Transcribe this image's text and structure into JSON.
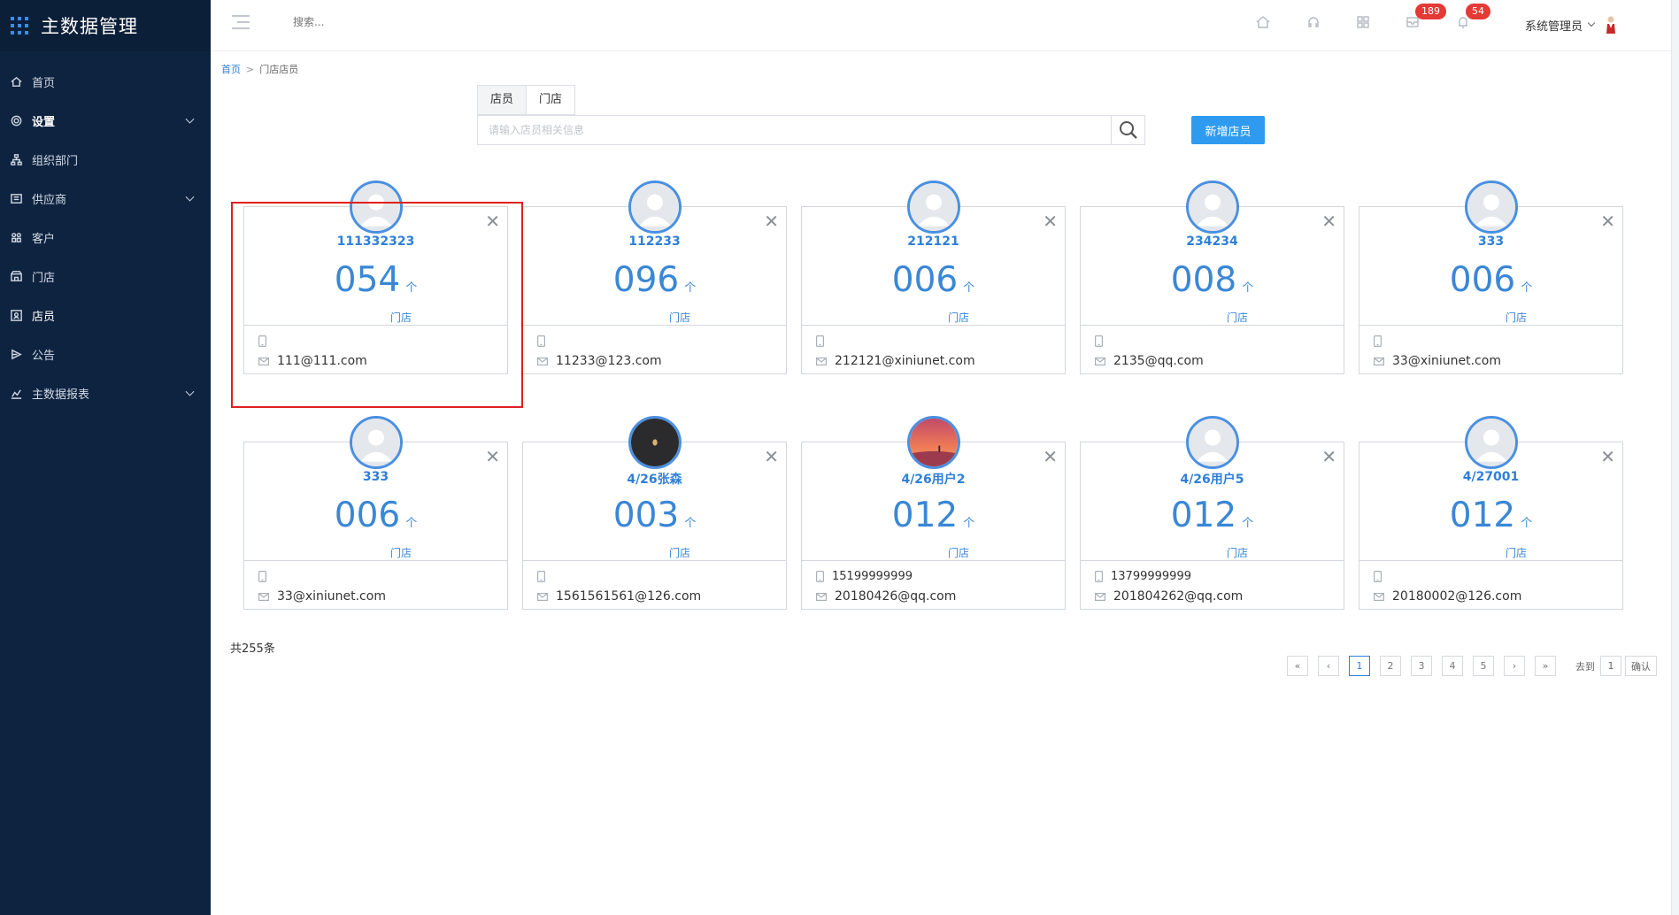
{
  "app": {
    "title": "主数据管理"
  },
  "sidebar": {
    "items": [
      {
        "label": "首页",
        "icon": "home-icon",
        "expandable": false
      },
      {
        "label": "设置",
        "icon": "gear-icon",
        "expandable": true
      },
      {
        "label": "组织部门",
        "icon": "org-chart-icon",
        "expandable": false
      },
      {
        "label": "供应商",
        "icon": "supplier-icon",
        "expandable": true
      },
      {
        "label": "客户",
        "icon": "customer-icon",
        "expandable": false
      },
      {
        "label": "门店",
        "icon": "store-icon",
        "expandable": false
      },
      {
        "label": "店员",
        "icon": "clerk-icon",
        "expandable": false,
        "active": true
      },
      {
        "label": "公告",
        "icon": "announcement-icon",
        "expandable": false
      },
      {
        "label": "主数据报表",
        "icon": "chart-icon",
        "expandable": true
      }
    ]
  },
  "topbar": {
    "search_placeholder": "搜索...",
    "messages_badge": "189",
    "notifications_badge": "54",
    "user_name": "系统管理员"
  },
  "breadcrumb": {
    "home": "首页",
    "separator": ">",
    "current": "门店店员"
  },
  "tabs": [
    {
      "label": "店员",
      "active": true
    },
    {
      "label": "门店",
      "active": false
    }
  ],
  "search": {
    "placeholder": "请输入店员相关信息",
    "value": ""
  },
  "add_button": "新增店员",
  "cards": [
    {
      "name": "111332323",
      "count": "054",
      "unit": "个",
      "link": "门店",
      "phone": "",
      "email": "111@111.com",
      "avatar": "default"
    },
    {
      "name": "112233",
      "count": "096",
      "unit": "个",
      "link": "门店",
      "phone": "",
      "email": "11233@123.com",
      "avatar": "default"
    },
    {
      "name": "212121",
      "count": "006",
      "unit": "个",
      "link": "门店",
      "phone": "",
      "email": "212121@xiniunet.com",
      "avatar": "default"
    },
    {
      "name": "234234",
      "count": "008",
      "unit": "个",
      "link": "门店",
      "phone": "",
      "email": "2135@qq.com",
      "avatar": "default"
    },
    {
      "name": "333",
      "count": "006",
      "unit": "个",
      "link": "门店",
      "phone": "",
      "email": "33@xiniunet.com",
      "avatar": "default"
    },
    {
      "name": "333",
      "count": "006",
      "unit": "个",
      "link": "门店",
      "phone": "",
      "email": "33@xiniunet.com",
      "avatar": "default"
    },
    {
      "name": "4/26张森",
      "count": "003",
      "unit": "个",
      "link": "门店",
      "phone": "",
      "email": "1561561561@126.com",
      "avatar": "dark"
    },
    {
      "name": "4/26用户2",
      "count": "012",
      "unit": "个",
      "link": "门店",
      "phone": "15199999999",
      "email": "20180426@qq.com",
      "avatar": "sunset"
    },
    {
      "name": "4/26用户5",
      "count": "012",
      "unit": "个",
      "link": "门店",
      "phone": "13799999999",
      "email": "201804262@qq.com",
      "avatar": "default"
    },
    {
      "name": "4/27001",
      "count": "012",
      "unit": "个",
      "link": "门店",
      "phone": "",
      "email": "20180002@126.com",
      "avatar": "default"
    }
  ],
  "total": "共255条",
  "pagination": {
    "first": "«",
    "prev": "‹",
    "pages": [
      "1",
      "2",
      "3",
      "4",
      "5"
    ],
    "current": "1",
    "next": "›",
    "last": "»",
    "goto_label": "去到",
    "goto_value": "1",
    "confirm": "确认"
  },
  "colors": {
    "accent": "#2f7fd8",
    "sidebar_bg": "#0e2340",
    "badge": "#e53935",
    "highlight": "#e02020"
  }
}
